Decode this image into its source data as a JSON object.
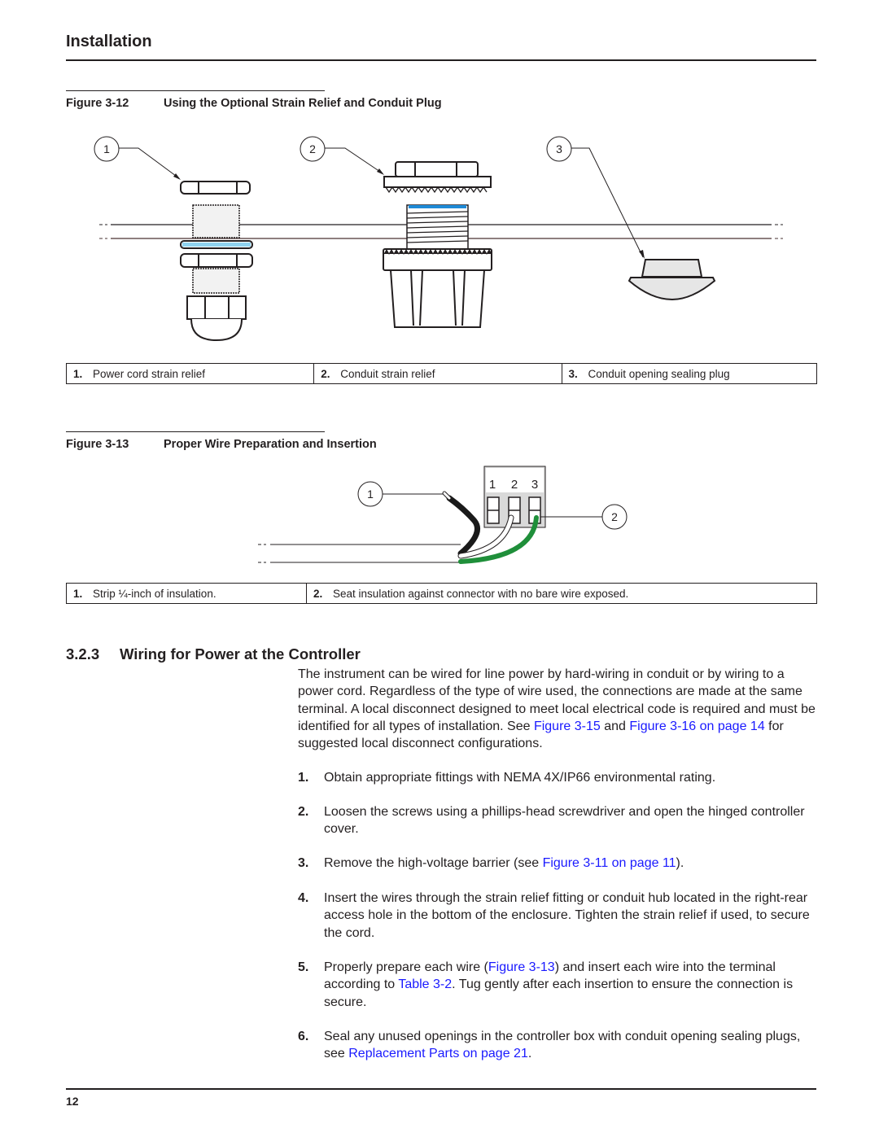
{
  "header": {
    "title": "Installation"
  },
  "figure_12": {
    "number": "Figure 3-12",
    "title": "Using the Optional Strain Relief and Conduit Plug",
    "callouts": [
      "1",
      "2",
      "3"
    ],
    "colors": {
      "gasket_blue": "#8fd3f0",
      "thread_blue": "#1e8ad6",
      "plug_fill": "#e6e6e6",
      "panel_line": "#4a3333"
    },
    "legend": [
      {
        "num": "1.",
        "text": "Power cord strain relief"
      },
      {
        "num": "2.",
        "text": "Conduit strain relief"
      },
      {
        "num": "3.",
        "text": "Conduit opening sealing plug"
      }
    ]
  },
  "figure_13": {
    "number": "Figure 3-13",
    "title": "Proper Wire Preparation and Insertion",
    "callouts": [
      "1",
      "2"
    ],
    "terminal_labels": [
      "1",
      "2",
      "3"
    ],
    "colors": {
      "wire_black": "#1a1a1a",
      "wire_white": "#ffffff",
      "wire_green": "#1f8f3a",
      "terminal_fill": "#d9d9d9"
    },
    "legend": [
      {
        "num": "1.",
        "text": "Strip ¼-inch of insulation."
      },
      {
        "num": "2.",
        "text": "Seat insulation against connector with no bare wire exposed."
      }
    ]
  },
  "section": {
    "number": "3.2.3",
    "title": "Wiring for Power at the Controller",
    "intro": {
      "part1": "The instrument can be wired for line power by hard-wiring in conduit or by wiring to a power cord. Regardless of the type of wire used, the connections are made at the same terminal. A local disconnect designed to meet local electrical code is required and must be identified for all types of installation. See ",
      "link1": "Figure 3-15",
      "part2": " and ",
      "link2": "Figure 3-16 on page 14",
      "part3": " for suggested local disconnect configurations."
    },
    "steps": [
      {
        "num": "1.",
        "text": "Obtain appropriate fittings with NEMA 4X/IP66 environmental rating."
      },
      {
        "num": "2.",
        "text": "Loosen the screws using a phillips-head screwdriver and open the hinged controller cover."
      },
      {
        "num": "3.",
        "pre": "Remove the high-voltage barrier (see ",
        "link": "Figure 3-11 on page 11",
        "post": ")."
      },
      {
        "num": "4.",
        "text": "Insert the wires through the strain relief fitting or conduit hub located in the right-rear access hole in the bottom of the enclosure. Tighten the strain relief if used, to secure the cord."
      },
      {
        "num": "5.",
        "pre": "Properly prepare each wire (",
        "link": "Figure 3-13",
        "mid": ") and insert each wire into the terminal according to ",
        "link2": "Table 3-2",
        "post": ". Tug gently after each insertion to ensure the connection is secure."
      },
      {
        "num": "6.",
        "pre": "Seal any unused openings in the controller box with conduit opening sealing plugs, see ",
        "link": "Replacement Parts on page 21",
        "post": "."
      }
    ]
  },
  "footer": {
    "page_number": "12"
  },
  "link_color": "#1a1aff"
}
